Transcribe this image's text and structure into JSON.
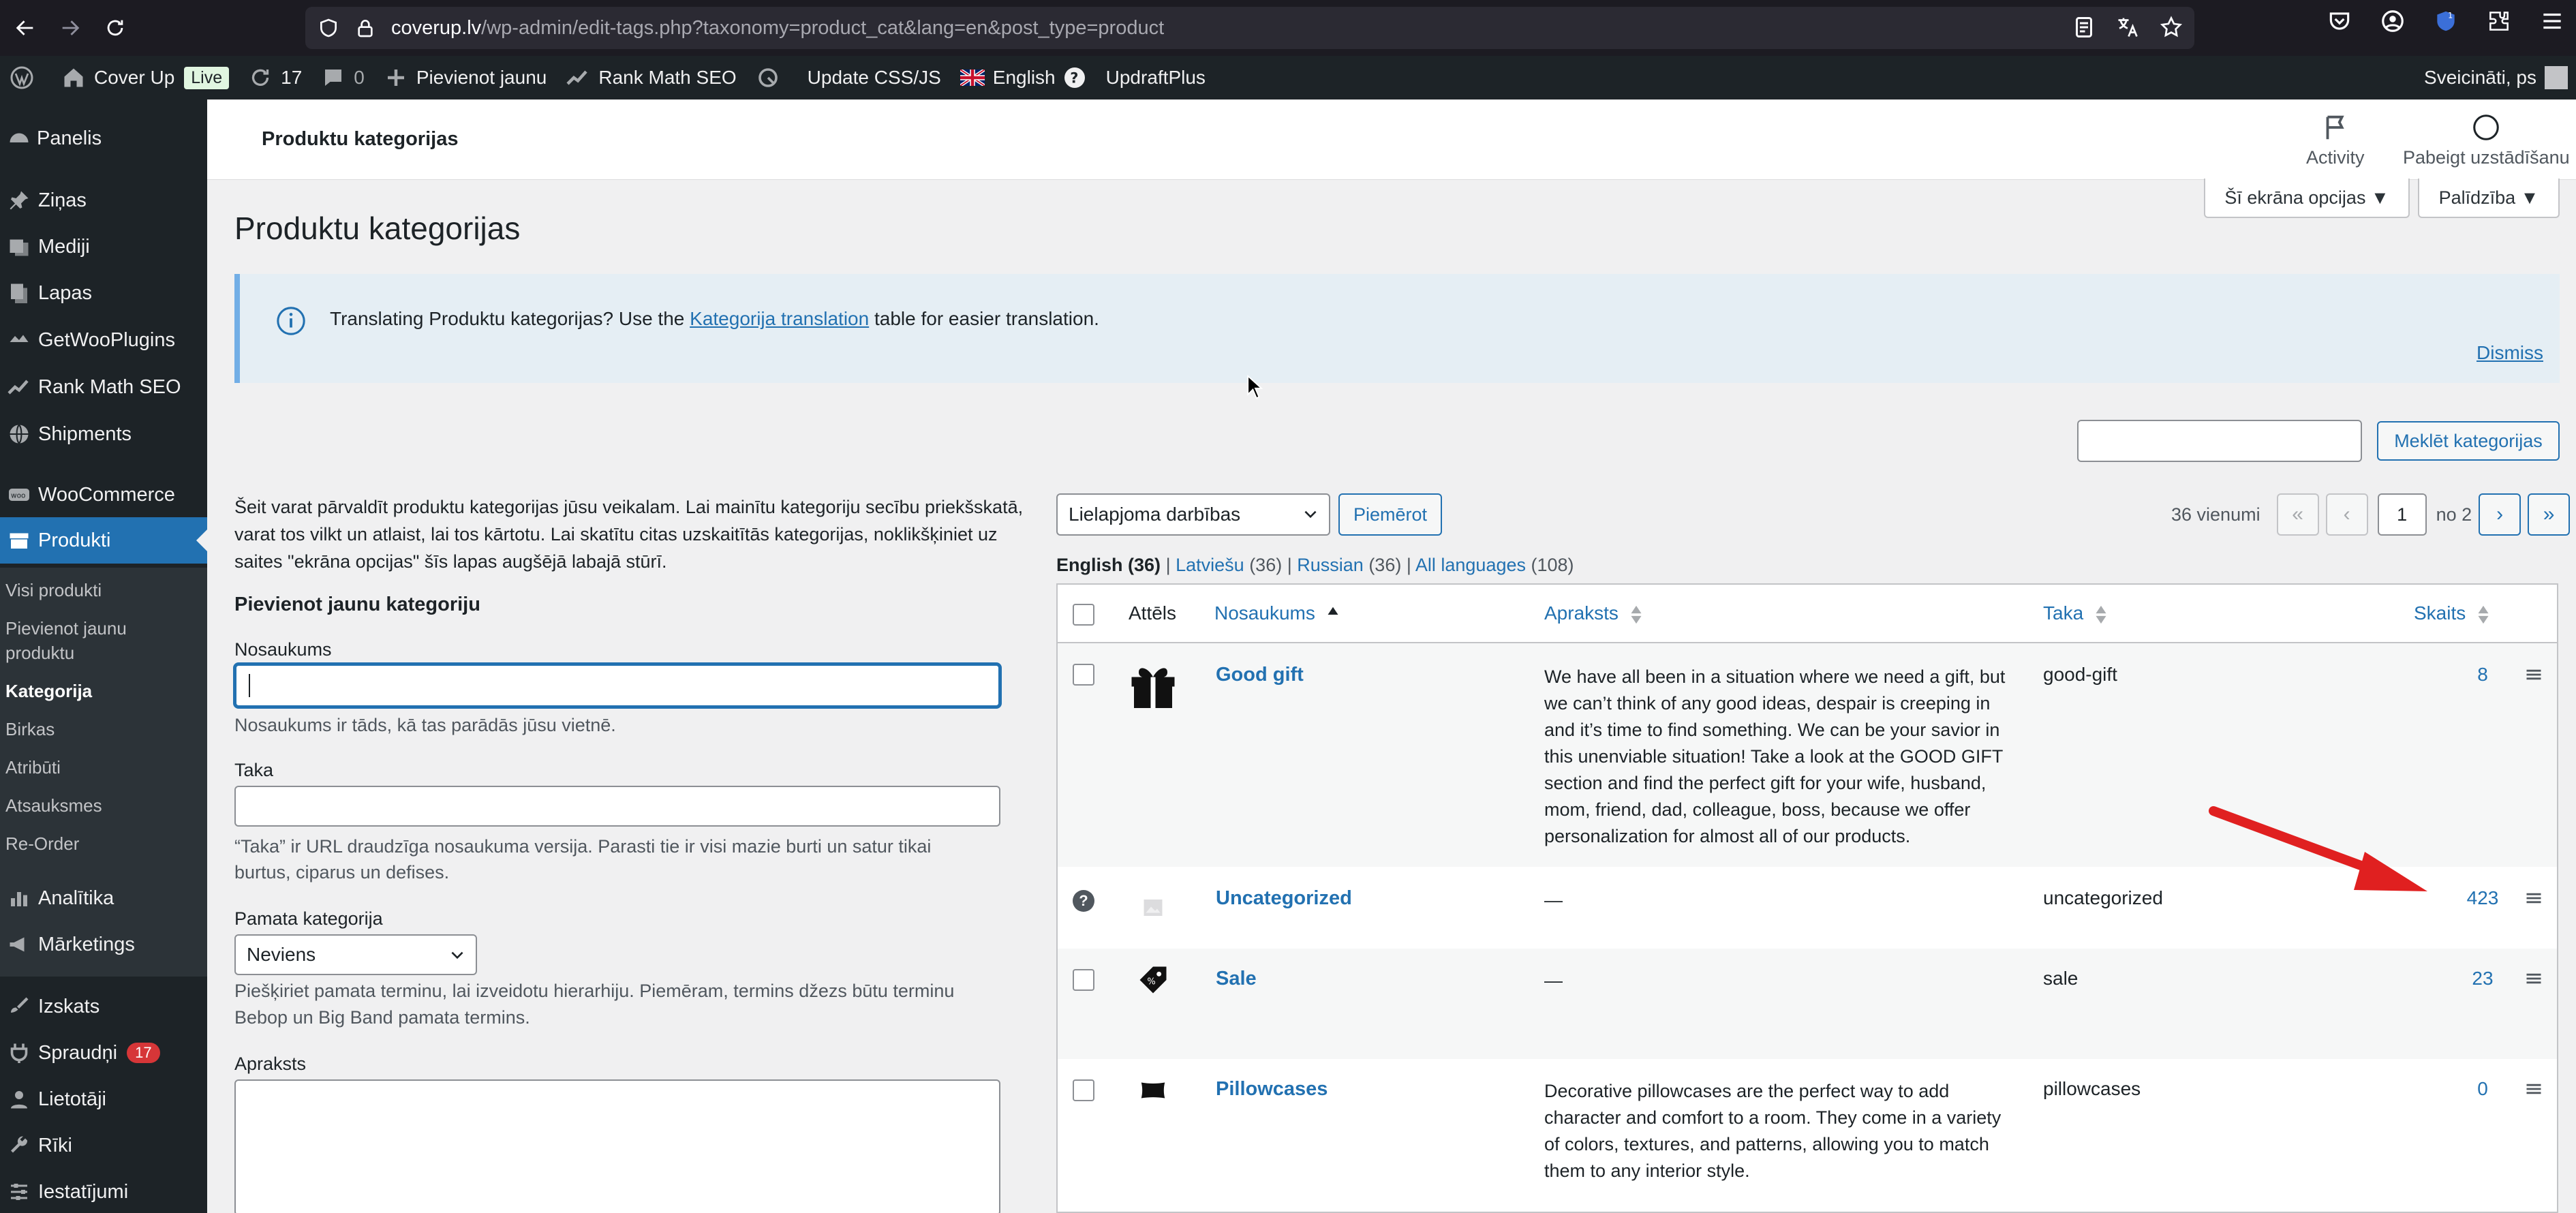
{
  "browser": {
    "url_host": "coverup.lv",
    "url_path": "/wp-admin/edit-tags.php?taxonomy=product_cat&lang=en&post_type=product",
    "extension_badge": "1"
  },
  "adminbar": {
    "site_name": "Cover Up",
    "live_label": "Live",
    "updates_count": "17",
    "comments_count": "0",
    "new_label": "Pievienot jaunu",
    "rankmath_label": "Rank Math SEO",
    "css_label": "Update CSS/JS",
    "language_label": "English",
    "updraft_label": "UpdraftPlus",
    "greeting": "Sveicināti, ps"
  },
  "sidebar": {
    "items": [
      {
        "label": "Panelis"
      },
      {
        "label": "Ziņas"
      },
      {
        "label": "Mediji"
      },
      {
        "label": "Lapas"
      },
      {
        "label": "GetWooPlugins"
      },
      {
        "label": "Rank Math SEO"
      },
      {
        "label": "Shipments"
      },
      {
        "label": "WooCommerce"
      },
      {
        "label": "Produkti"
      },
      {
        "label": "Analītika"
      },
      {
        "label": "Mārketings"
      },
      {
        "label": "Izskats"
      },
      {
        "label": "Spraudņi",
        "badge": "17"
      },
      {
        "label": "Lietotāji"
      },
      {
        "label": "Rīki"
      },
      {
        "label": "Iestatījumi"
      }
    ],
    "submenu": [
      {
        "label": "Visi produkti"
      },
      {
        "label": "Pievienot jaunu"
      },
      {
        "label": "produktu"
      },
      {
        "label": "Kategorija"
      },
      {
        "label": "Birkas"
      },
      {
        "label": "Atribūti"
      },
      {
        "label": "Atsauksmes"
      },
      {
        "label": "Re-Order"
      }
    ]
  },
  "header": {
    "title": "Produktu kategorijas",
    "activity_label": "Activity",
    "finish_label": "Pabeigt uzstādīšanu",
    "screen_options": "Šī ekrāna opcijas ▼",
    "help": "Palīdzība ▼"
  },
  "main": {
    "title": "Produktu kategorijas",
    "notice_pre": "Translating Produktu kategorijas? Use the ",
    "notice_link": "Kategorija translation",
    "notice_post": " table for easier translation.",
    "dismiss": "Dismiss",
    "search_button": "Meklēt kategorijas"
  },
  "form": {
    "intro_1": "Šeit varat pārvaldīt produktu kategorijas jūsu veikalam. Lai mainītu kategoriju secību priekšskatā,",
    "intro_2": "varat tos vilkt un atlaist, lai tos kārtotu. Lai skatītu citas uzskaitītās kategorijas, noklikšķiniet uz",
    "intro_3": "saites \"ekrāna opcijas\" šīs lapas augšējā labajā stūrī.",
    "heading": "Pievienot jaunu kategoriju",
    "name_label": "Nosaukums",
    "name_value": "",
    "name_help": "Nosaukums ir tāds, kā tas parādās jūsu vietnē.",
    "slug_label": "Taka",
    "slug_value": "",
    "slug_help_1": "“Taka” ir URL draudzīga nosaukuma versija. Parasti tie ir visi mazie burti un satur tikai",
    "slug_help_2": "burtus, ciparus un defises.",
    "parent_label": "Pamata kategorija",
    "parent_value": "Neviens",
    "parent_help_1": "Piešķiriet pamata terminu, lai izveidotu hierarhiju. Piemēram, termins džezs būtu terminu",
    "parent_help_2": "Bebop un Big Band pamata termins.",
    "desc_label": "Apraksts"
  },
  "list": {
    "bulk_select": "Lielapjoma darbības",
    "apply_button": "Piemērot",
    "items_count": "36 vienumi",
    "page_input": "1",
    "page_of": "no 2",
    "languages": {
      "english": "English",
      "english_count": "(36)",
      "sep": "|",
      "latvian": "Latviešu",
      "latvian_count": "(36)",
      "russian": "Russian",
      "russian_count": "(36)",
      "all": "All languages",
      "all_count": "(108)"
    },
    "columns": {
      "image": "Attēls",
      "name": "Nosaukums",
      "description": "Apraksts",
      "slug": "Taka",
      "count": "Skaits"
    },
    "rows": [
      {
        "name": "Good gift",
        "desc": [
          "We have all been in a situation where we need a gift, but",
          "we can’t think of any good ideas, despair is creeping in",
          "and it’s time to find something. We can be your savior in",
          "this unenviable situation! Take a look at the GOOD GIFT",
          "section and find the perfect gift for your wife, husband,",
          "mom, friend, dad, colleague, boss, because we offer",
          "personalization for almost all of our products."
        ],
        "slug": "good-gift",
        "count": "8"
      },
      {
        "name": "Uncategorized",
        "desc": [
          "—"
        ],
        "slug": "uncategorized",
        "count": "423"
      },
      {
        "name": "Sale",
        "desc": [
          "—"
        ],
        "slug": "sale",
        "count": "23"
      },
      {
        "name": "Pillowcases",
        "desc": [
          "Decorative pillowcases are the perfect way to add",
          "character and comfort to a room. They come in a variety",
          "of colors, textures, and patterns, allowing you to match",
          "them to any interior style."
        ],
        "slug": "pillowcases",
        "count": "0"
      }
    ]
  },
  "colors": {
    "accent": "#2271b1",
    "adminbar": "#1d2327",
    "arrow": "#e02020"
  }
}
